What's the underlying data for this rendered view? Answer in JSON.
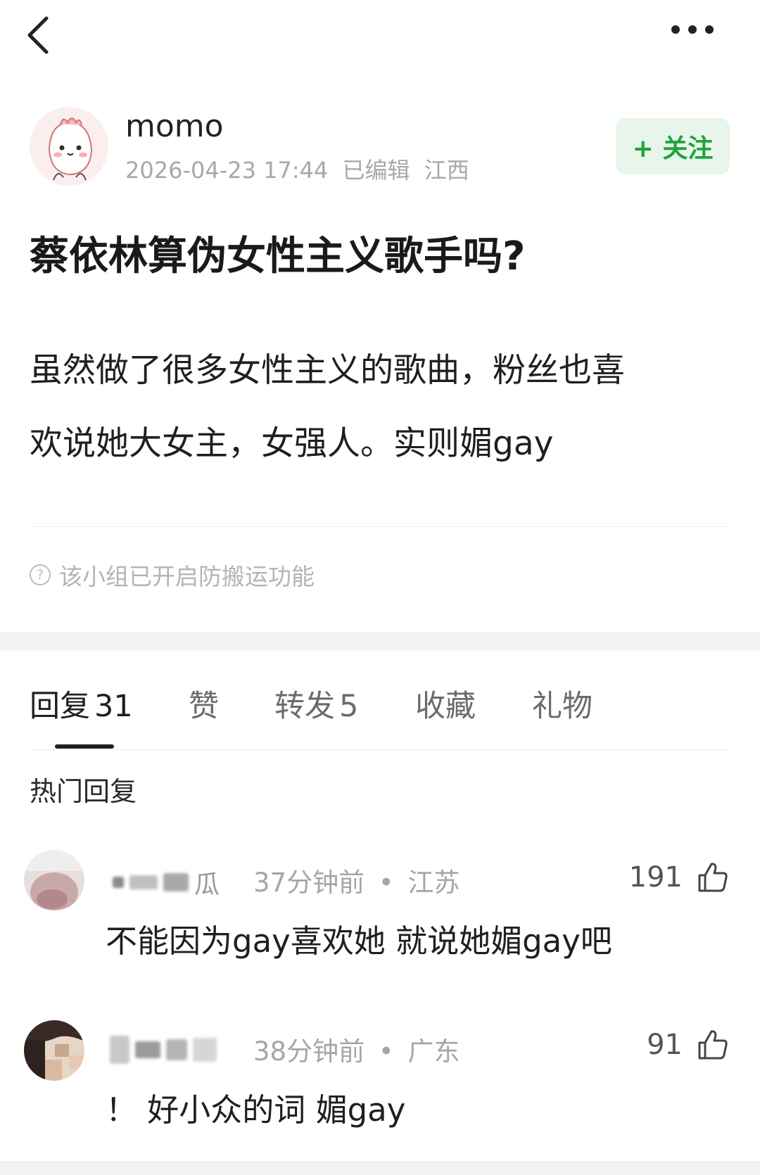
{
  "post": {
    "author": "momo",
    "date": "2026-04-23 17:44",
    "edited": "已编辑",
    "location": "江西",
    "follow_label": "+ 关注",
    "title": "蔡依林算伪女性主义歌手吗?",
    "body_line1": "虽然做了很多女性主义的歌曲，粉丝也喜",
    "body_line2": "欢说她大女主，女强人。实则媚gay",
    "anti_copy_notice": "该小组已开启防搬运功能"
  },
  "tabs": [
    {
      "label": "回复",
      "count": "31"
    },
    {
      "label": "赞",
      "count": ""
    },
    {
      "label": "转发",
      "count": "5"
    },
    {
      "label": "收藏",
      "count": ""
    },
    {
      "label": "礼物",
      "count": ""
    }
  ],
  "hot_replies_title": "热门回复",
  "comments": [
    {
      "name_visible": "瓜",
      "time": "37分钟前",
      "location": "江苏",
      "text": "不能因为gay喜欢她 就说她媚gay吧",
      "likes": "191"
    },
    {
      "name_visible": "",
      "time": "38分钟前",
      "location": "广东",
      "text": "！ 好小众的词 媚gay",
      "likes": "91"
    }
  ],
  "meta_separator": "•",
  "icons": {
    "back": "back-arrow-icon",
    "more": "more-dots-icon",
    "help": "question-circle-icon",
    "like": "thumbs-up-icon"
  },
  "colors": {
    "follow_green": "#1fa33c",
    "follow_bg": "#e7f5ea",
    "muted_text": "#a8a8a8"
  }
}
